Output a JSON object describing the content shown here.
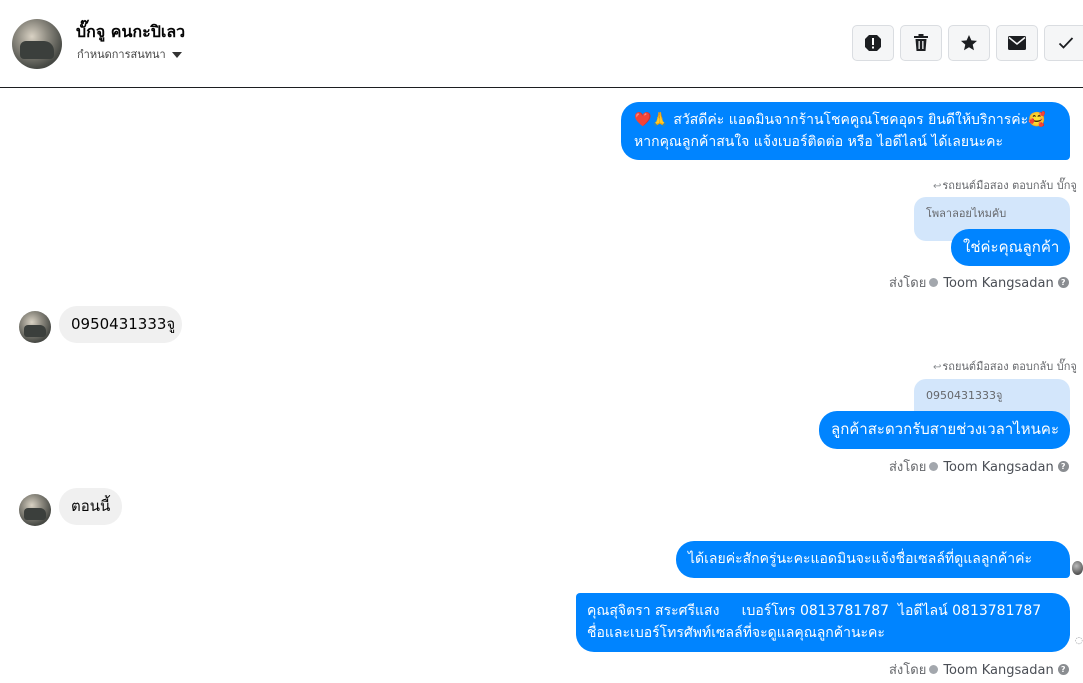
{
  "header": {
    "contact_name": "บั๊กจู คนกะปิเลว",
    "conversation_setting": "กำหนดการสนทนา",
    "actions": [
      {
        "icon": "alert-icon",
        "name": "report"
      },
      {
        "icon": "trash-icon",
        "name": "delete"
      },
      {
        "icon": "star-icon",
        "name": "star"
      },
      {
        "icon": "mail-icon",
        "name": "mark-unread"
      },
      {
        "icon": "check-icon",
        "name": "mark-done"
      }
    ]
  },
  "messages": {
    "m1": {
      "line1_emoji_a": "❤️🙏",
      "line1_text": " สวัสดีค่ะ แอดมินจากร้านโชคคูณโชคอุดร ยินดีให้บริการค่ะ",
      "line1_emoji_b": "🥰",
      "line2": "หากคุณลูกค้าสนใจ แจ้งเบอร์ติดต่อ หรือ ไอดีไลน์ ได้เลยนะคะ"
    },
    "reply1": {
      "label": "รถยนต์มือสอง ตอบกลับ บั๊กจู",
      "quoted": "โพลาลอยไหมคับ",
      "text": "ใช่ค่ะคุณลูกค้า"
    },
    "sent_by1": {
      "prefix": "ส่งโดย",
      "agent": "Toom Kangsadan"
    },
    "in1": "0950431333จู",
    "reply2": {
      "label": "รถยนต์มือสอง ตอบกลับ บั๊กจู",
      "quoted": "0950431333จู",
      "text": "ลูกค้าสะดวกรับสายช่วงเวลาไหนคะ"
    },
    "sent_by2": {
      "prefix": "ส่งโดย",
      "agent": "Toom Kangsadan"
    },
    "in2": "ตอนนี้",
    "m3": "ได้เลยค่ะสักครู่นะคะแอดมินจะแจ้งชื่อเซลล์ที่ดูแลลูกค้าค่ะ",
    "m4": {
      "line1": "คุณสุจิตรา สระศรีแสง     เบอร์โทร 0813781787  ไอดีไลน์ 0813781787",
      "line2": "ชื่อและเบอร์โทรศัพท์เซลล์ที่จะดูแลคุณลูกค้านะคะ"
    },
    "sent_by3": {
      "prefix": "ส่งโดย",
      "agent": "Toom Kangsadan"
    }
  },
  "colors": {
    "outgoing_bubble": "#0084ff",
    "incoming_bubble": "#f0f0f0",
    "quote_bubble": "#d3e6fb",
    "meta_text": "#65676b"
  }
}
